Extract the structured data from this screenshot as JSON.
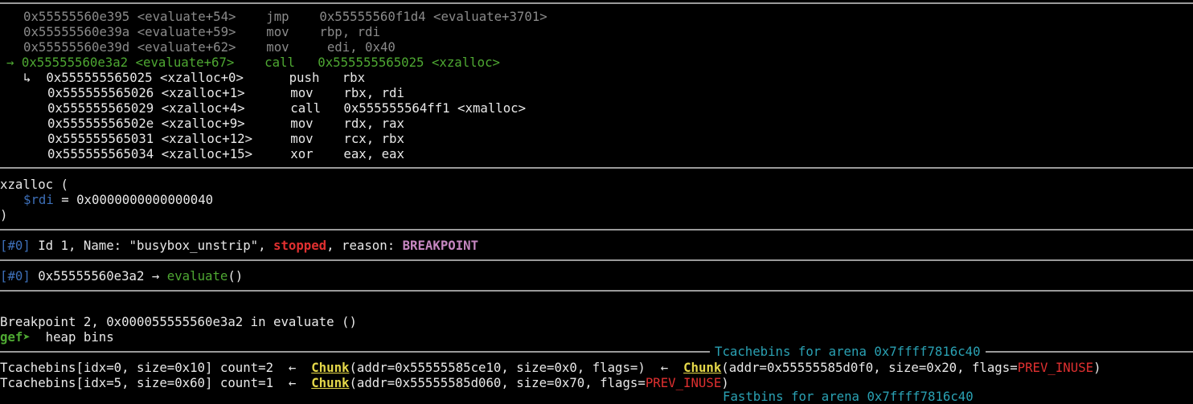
{
  "disasm_past": [
    {
      "addr": "0x55555560e395",
      "sym": "<evaluate+54>",
      "op": "jmp",
      "args": "0x55555560f1d4 <evaluate+3701>"
    },
    {
      "addr": "0x55555560e39a",
      "sym": "<evaluate+59>",
      "op": "mov",
      "args": "rbp, rdi"
    },
    {
      "addr": "0x55555560e39d",
      "sym": "<evaluate+62>",
      "op": "mov",
      "args": "edi, 0x40"
    }
  ],
  "disasm_current": {
    "marker": "→",
    "addr": "0x55555560e3a2",
    "sym": "<evaluate+67>",
    "op": "call",
    "args": "0x555555565025 <xzalloc>"
  },
  "disasm_target": [
    {
      "marker": "↳",
      "addr": "0x555555565025",
      "sym": "<xzalloc+0>",
      "op": "push",
      "args": "rbx"
    },
    {
      "marker": "",
      "addr": "0x555555565026",
      "sym": "<xzalloc+1>",
      "op": "mov",
      "args": "rbx, rdi"
    },
    {
      "marker": "",
      "addr": "0x555555565029",
      "sym": "<xzalloc+4>",
      "op": "call",
      "args": "0x555555564ff1 <xmalloc>"
    },
    {
      "marker": "",
      "addr": "0x55555556502e",
      "sym": "<xzalloc+9>",
      "op": "mov",
      "args": "rdx, rax"
    },
    {
      "marker": "",
      "addr": "0x555555565031",
      "sym": "<xzalloc+12>",
      "op": "mov",
      "args": "rcx, rbx"
    },
    {
      "marker": "",
      "addr": "0x555555565034",
      "sym": "<xzalloc+15>",
      "op": "xor",
      "args": "eax, eax"
    }
  ],
  "args_block": {
    "open": "xzalloc (",
    "reg": "$rdi",
    "eq": " = 0x0000000000000040",
    "close": ")"
  },
  "threads": {
    "idx": "[#0]",
    "pre": " Id 1, Name: \"busybox_unstrip\", ",
    "state": "stopped",
    "mid": ", reason: ",
    "reason": "BREAKPOINT"
  },
  "trace": {
    "idx": "[#0]",
    "addr": " 0x55555560e3a2 → ",
    "func": "evaluate",
    "suffix": "()"
  },
  "console": {
    "breakpoint_msg": "Breakpoint 2, 0x000055555560e3a2 in evaluate ()",
    "prompt": "gef➤",
    "command": "  heap bins"
  },
  "tcache": {
    "header": "Tcachebins for arena 0x7ffff7816c40",
    "rows": [
      {
        "prefix": "Tcachebins[idx=0, size=0x10] count=2  ←  ",
        "chunks": [
          {
            "label": "Chunk",
            "body": "(addr=0x55555585ce10, size=0x0, flags=",
            "flag": "",
            "close": ")"
          },
          {
            "label": "Chunk",
            "body": "(addr=0x55555585d0f0, size=0x20, flags=",
            "flag": "PREV_INUSE",
            "close": ")"
          }
        ],
        "sep": "  ←  "
      },
      {
        "prefix": "Tcachebins[idx=5, size=0x60] count=1  ←  ",
        "chunks": [
          {
            "label": "Chunk",
            "body": "(addr=0x55555585d060, size=0x70, flags=",
            "flag": "PREV_INUSE",
            "close": ")"
          }
        ],
        "sep": ""
      }
    ],
    "next_header_partial": "Fastbins for arena 0x7ffff7816c40"
  }
}
